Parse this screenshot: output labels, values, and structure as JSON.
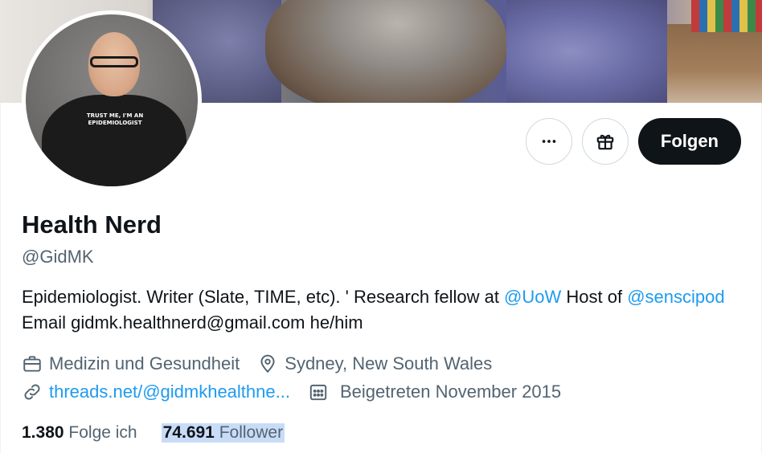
{
  "profile": {
    "name": "Health Nerd",
    "handle": "@GidMK",
    "avatar_shirt_text": "TRUST ME, I'M AN EPIDEMIOLOGIST"
  },
  "actions": {
    "more_icon": "more-dots-icon",
    "gift_icon": "gift-icon",
    "follow_label": "Folgen"
  },
  "bio": {
    "part1": "Epidemiologist. Writer (Slate, TIME, etc). ' Research fellow at ",
    "mention1": "@UoW",
    "part2": " Host of ",
    "mention2": "@senscipod",
    "part3": " Email gidmk.healthnerd@gmail.com he/him"
  },
  "meta": {
    "category": "Medizin und Gesundheit",
    "location": "Sydney, New South Wales",
    "website": "threads.net/@gidmkhealthne...",
    "joined": "Beigetreten November 2015"
  },
  "stats": {
    "following_count": "1.380",
    "following_label": "Folge ich",
    "followers_count": "74.691",
    "followers_label": "Follower"
  },
  "colors": {
    "text": "#0f1419",
    "secondary": "#536471",
    "link": "#1d9bf0",
    "button": "#0f1419",
    "highlight": "#c9dcf7"
  }
}
